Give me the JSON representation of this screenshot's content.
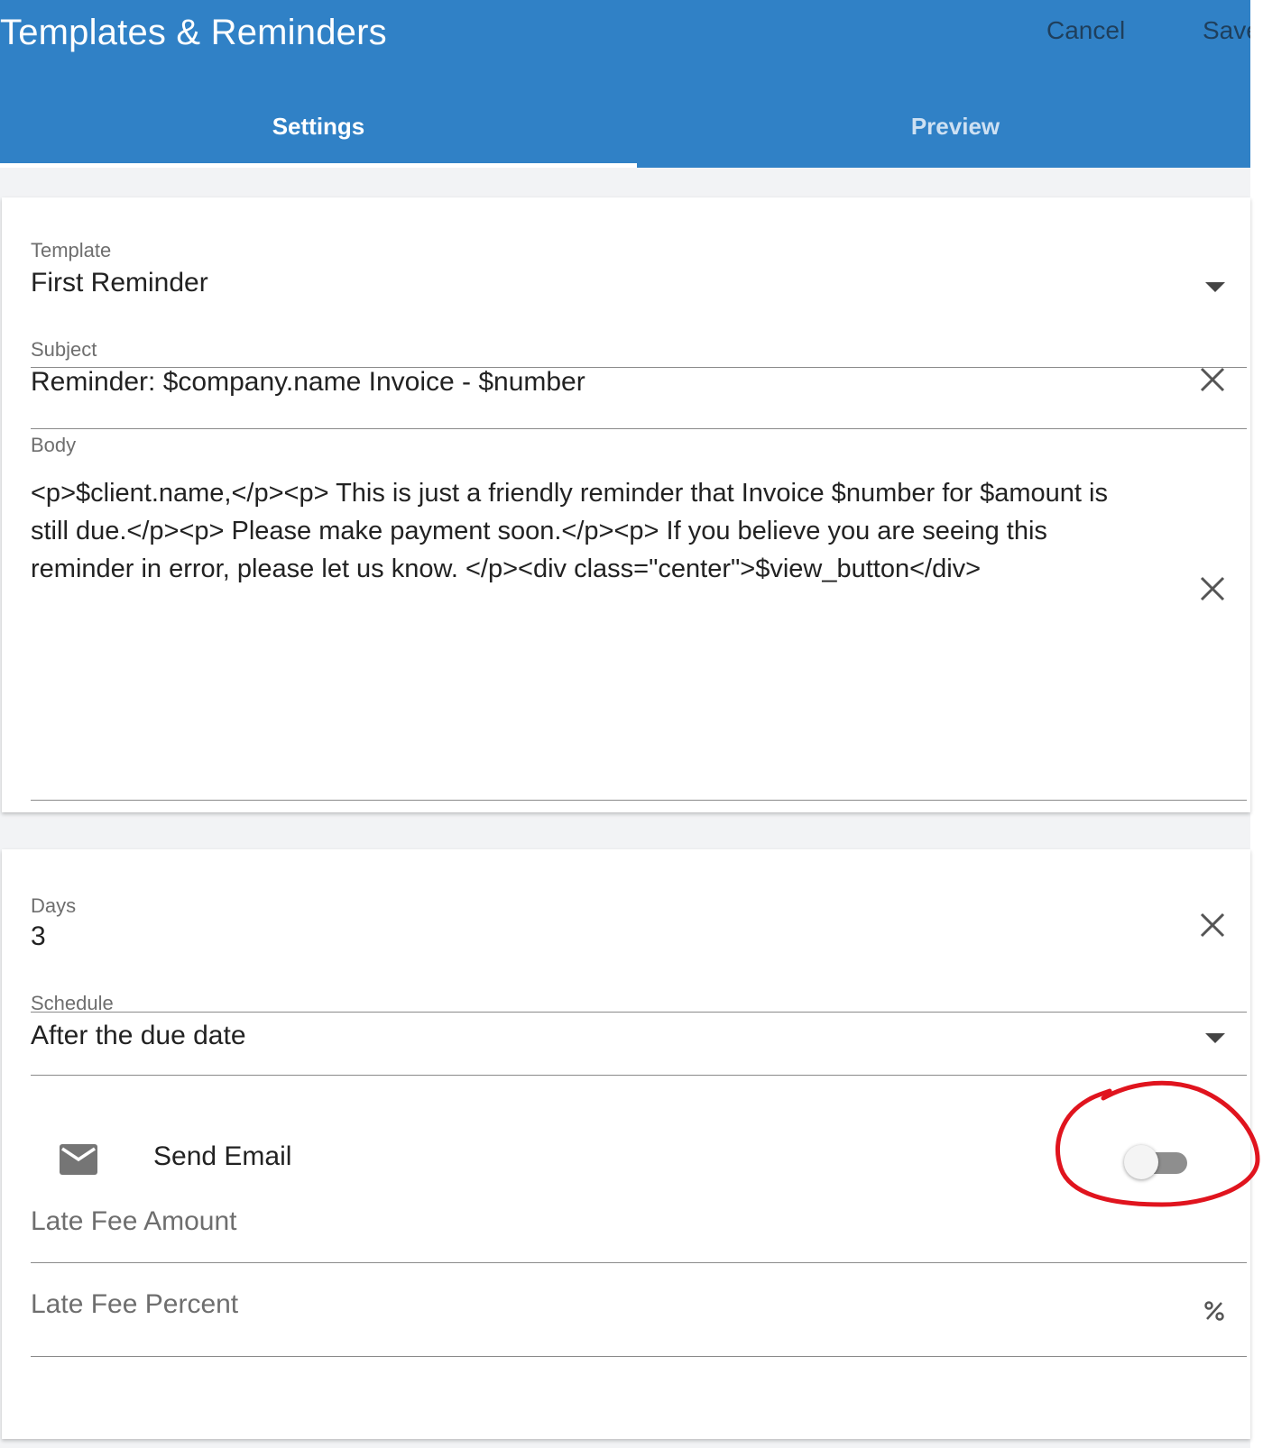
{
  "app_bar": {
    "title": "Templates & Reminders",
    "cancel_label": "Cancel",
    "save_label": "Save",
    "background_color": "#3081c6"
  },
  "tabs": [
    {
      "label": "Settings",
      "selected": true
    },
    {
      "label": "Preview",
      "selected": false
    }
  ],
  "template_card": {
    "template": {
      "label": "Template",
      "value": "First Reminder",
      "icon": "arrow-drop-down-icon"
    },
    "subject": {
      "label": "Subject",
      "value": "Reminder: $company.name Invoice - $number",
      "icon": "clear-icon"
    },
    "body": {
      "label": "Body",
      "value": "<p>$client.name,</p><p> This is just a friendly reminder that Invoice $number for $amount is still due.</p><p> Please make payment soon.</p><p> If you believe you are seeing this reminder in error, please let us know. </p><div class=\"center\">$view_button</div>",
      "icon": "clear-icon"
    }
  },
  "settings_card": {
    "days": {
      "label": "Days",
      "value": "3",
      "icon": "clear-icon"
    },
    "schedule": {
      "label": "Schedule",
      "value": "After the due date",
      "icon": "arrow-drop-down-icon"
    },
    "send_email": {
      "label": "Send Email",
      "icon": "email-icon",
      "enabled": false
    },
    "late_fee_amount": {
      "placeholder": "Late Fee Amount"
    },
    "late_fee_percent": {
      "placeholder": "Late Fee Percent",
      "icon": "percent-icon"
    }
  },
  "annotation": {
    "shape": "hand-drawn circle around toggle",
    "color": "#e0141e"
  }
}
